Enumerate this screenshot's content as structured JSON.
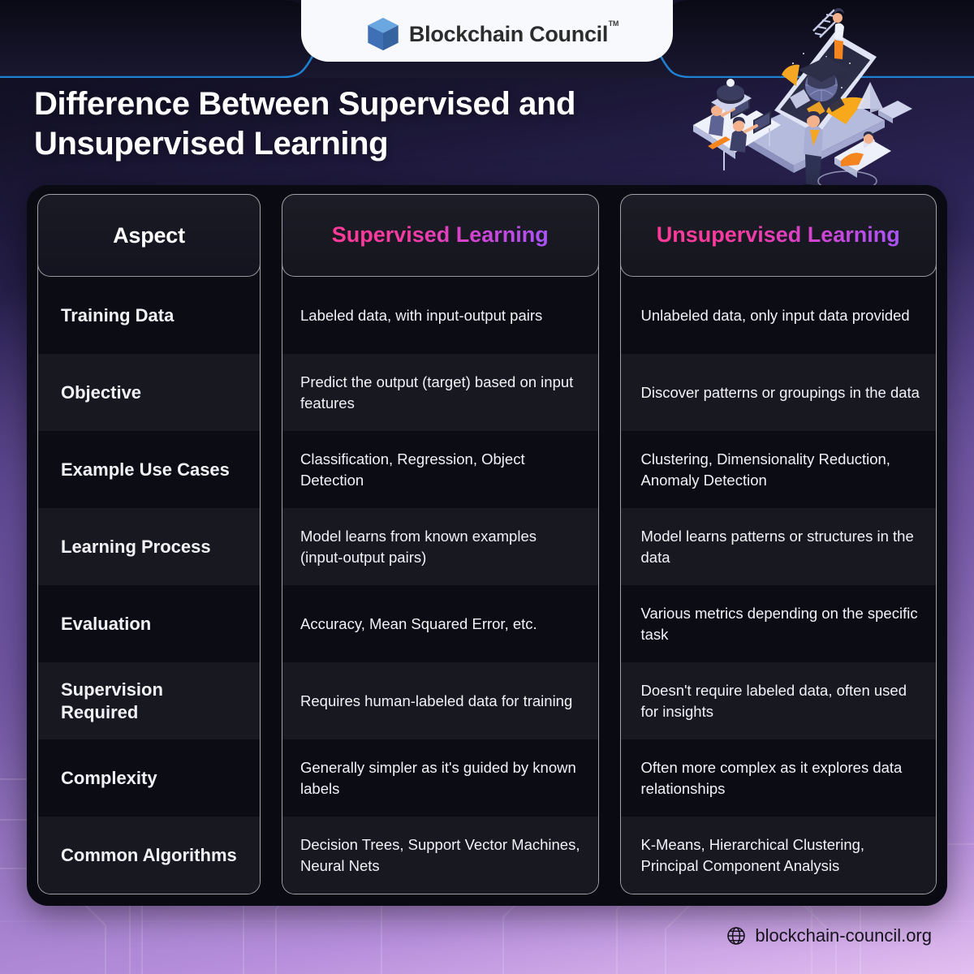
{
  "brand": {
    "name": "Blockchain Council",
    "trademark": "TM",
    "logo_icon": "cube-icon",
    "logo_colors": {
      "top": "#6aa7e0",
      "left": "#3f6fb5",
      "right": "#35639f"
    }
  },
  "headline": "Difference Between Supervised and Unsupervised Learning",
  "theme": {
    "accent_pink": "#ff3b97",
    "accent_purple": "#a855f7",
    "panel_bg": "#0a0a13",
    "row_odd": "#0c0c15",
    "row_even": "#181820",
    "background_top": "#0c0c18",
    "background_bottom": "#e3bff0",
    "topline_blue": "#1f86d8"
  },
  "table": {
    "headers": [
      "Aspect",
      "Supervised Learning",
      "Unsupervised Learning"
    ],
    "rows": [
      {
        "aspect": "Training Data",
        "supervised": "Labeled data, with input-output pairs",
        "unsupervised": "Unlabeled data, only input data provided"
      },
      {
        "aspect": "Objective",
        "supervised": "Predict the output (target) based on input features",
        "unsupervised": "Discover patterns or groupings in the data"
      },
      {
        "aspect": "Example Use Cases",
        "supervised": "Classification, Regression, Object Detection",
        "unsupervised": "Clustering, Dimensionality Reduction, Anomaly Detection"
      },
      {
        "aspect": "Learning Process",
        "supervised": "Model learns from known examples (input-output pairs)",
        "unsupervised": "Model learns patterns or structures in the data"
      },
      {
        "aspect": "Evaluation",
        "supervised": "Accuracy, Mean Squared Error, etc.",
        "unsupervised": "Various metrics depending on the specific task"
      },
      {
        "aspect": "Supervision Required",
        "supervised": "Requires human-labeled data for training",
        "unsupervised": "Doesn't require labeled data, often used for insights"
      },
      {
        "aspect": "Complexity",
        "supervised": "Generally simpler as it's guided by known labels",
        "unsupervised": "Often more complex as it explores data relationships"
      },
      {
        "aspect": "Common Algorithms",
        "supervised": "Decision Trees, Support Vector Machines, Neural Nets",
        "unsupervised": "K-Means, Hierarchical Clustering, Principal Component Analysis"
      }
    ]
  },
  "footer": {
    "icon": "globe-icon",
    "website": "blockchain-council.org"
  },
  "illustration": {
    "name": "isometric-elearning-illustration",
    "description": "People working around a large tablet showing a graduation cap"
  }
}
